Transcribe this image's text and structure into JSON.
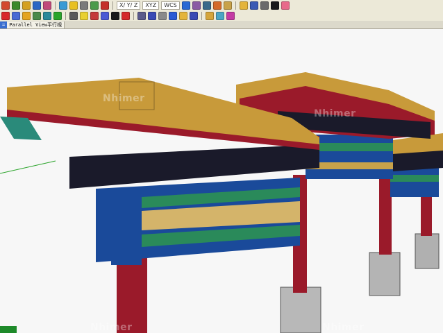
{
  "toolbar": {
    "readouts": {
      "wcs": "WCS",
      "xyz": "XYZ",
      "coordinates": "X/ Y/ Z"
    },
    "row1_icons": [
      {
        "name": "layers-icon",
        "color": "#d24a2c"
      },
      {
        "name": "check-icon",
        "color": "#3a8a2a"
      },
      {
        "name": "pen-icon",
        "color": "#d4a020"
      },
      {
        "name": "paint-icon",
        "color": "#2a66c4"
      },
      {
        "name": "shape-icon",
        "color": "#c04a7a"
      },
      {
        "name": "sphere-icon",
        "color": "#3a9ad4"
      },
      {
        "name": "bulb-icon",
        "color": "#e8c020"
      },
      {
        "name": "grid-icon",
        "color": "#7a7a7a"
      },
      {
        "name": "move-icon",
        "color": "#4a9a4a"
      },
      {
        "name": "rotate-icon",
        "color": "#c4302a"
      },
      {
        "name": "scale-icon",
        "color": "#2a6ad4"
      },
      {
        "name": "cube-icon",
        "color": "#8a5aa4"
      },
      {
        "name": "camera-icon",
        "color": "#3a6a8a"
      },
      {
        "name": "render-icon",
        "color": "#d46a2a"
      },
      {
        "name": "material-icon",
        "color": "#c8a24a"
      },
      {
        "name": "folder-icon",
        "color": "#e4b43a"
      },
      {
        "name": "save-icon",
        "color": "#3a5ab4"
      },
      {
        "name": "print-icon",
        "color": "#6a6a6a"
      },
      {
        "name": "select-icon",
        "color": "#1a1a1a"
      },
      {
        "name": "eraser-icon",
        "color": "#e86a8a"
      }
    ],
    "row2_icons": [
      {
        "name": "stop-icon",
        "color": "#d82a2a"
      },
      {
        "name": "ruler-icon",
        "color": "#4a6ad4"
      },
      {
        "name": "pencil-icon",
        "color": "#e4a420"
      },
      {
        "name": "texture-icon",
        "color": "#4a8a4a"
      },
      {
        "name": "chart-icon",
        "color": "#2a8a9a"
      },
      {
        "name": "help-icon",
        "color": "#2aa42a"
      },
      {
        "name": "snapshot-icon",
        "color": "#5a5a5a"
      },
      {
        "name": "light-icon",
        "color": "#e8d030"
      },
      {
        "name": "target-icon",
        "color": "#c43a3a"
      },
      {
        "name": "orbit-icon",
        "color": "#4a5ad4"
      },
      {
        "name": "play-icon",
        "color": "#1a1a1a"
      },
      {
        "name": "record-icon",
        "color": "#d42a2a"
      },
      {
        "name": "box-icon",
        "color": "#5a5a8a"
      },
      {
        "name": "pyramid-icon",
        "color": "#3a4ab4"
      },
      {
        "name": "lamp-icon",
        "color": "#8a8a8a"
      },
      {
        "name": "arrow-icon",
        "color": "#2a5ad4"
      },
      {
        "name": "open-icon",
        "color": "#e4b43a"
      },
      {
        "name": "disk-icon",
        "color": "#3a4ab4"
      },
      {
        "name": "tag-icon",
        "color": "#d4a43a"
      },
      {
        "name": "paint-bucket-icon",
        "color": "#4aa4c4"
      },
      {
        "name": "wand-icon",
        "color": "#c43aa4"
      }
    ]
  },
  "tabs": [
    {
      "label": "=",
      "active": true
    },
    {
      "label": "Parallel View平行視",
      "active": false
    }
  ],
  "viewport": {
    "background": "#f7f7f7",
    "watermarks": [
      "Nhimer",
      "Nhimer",
      "Nhimer",
      "Nhimer"
    ]
  },
  "colors": {
    "pillar": "#9a1a2a",
    "beam_blue": "#1a4a9a",
    "beam_green": "#2a8a5a",
    "roof_gold": "#c89a3a",
    "tile_dark": "#1a1a2a",
    "stone_base": "#b4b4b4",
    "axis_green": "#2aa42a"
  }
}
